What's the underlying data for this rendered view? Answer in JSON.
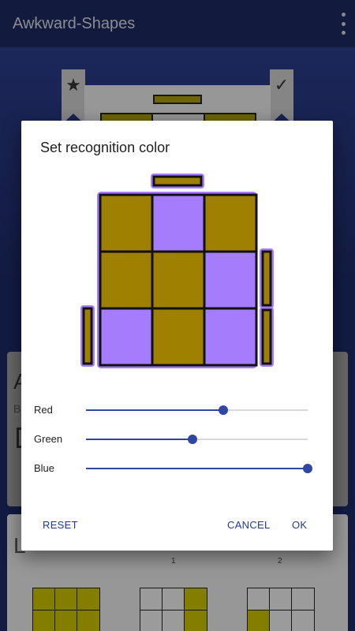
{
  "app": {
    "title": "Awkward-Shapes",
    "menu_icon": "overflow-menu-icon"
  },
  "background": {
    "ribbon_left_icon": "star-icon",
    "ribbon_left_glyph": "★",
    "ribbon_right_icon": "check-icon",
    "ribbon_right_glyph": "✓",
    "card_mid_heading": "A",
    "card_mid_subtext": "B",
    "card_bot_heading": "L",
    "card_bot_label_1": "1",
    "card_bot_label_2": "2"
  },
  "dialog": {
    "title": "Set recognition color",
    "colors": {
      "selected": "#a57cfc",
      "face": "#a08000",
      "outline": "#111111"
    },
    "sliders": [
      {
        "label": "Red",
        "value": 0.62
      },
      {
        "label": "Green",
        "value": 0.48
      },
      {
        "label": "Blue",
        "value": 1.0
      }
    ],
    "buttons": {
      "reset": "RESET",
      "cancel": "CANCEL",
      "ok": "OK"
    }
  }
}
